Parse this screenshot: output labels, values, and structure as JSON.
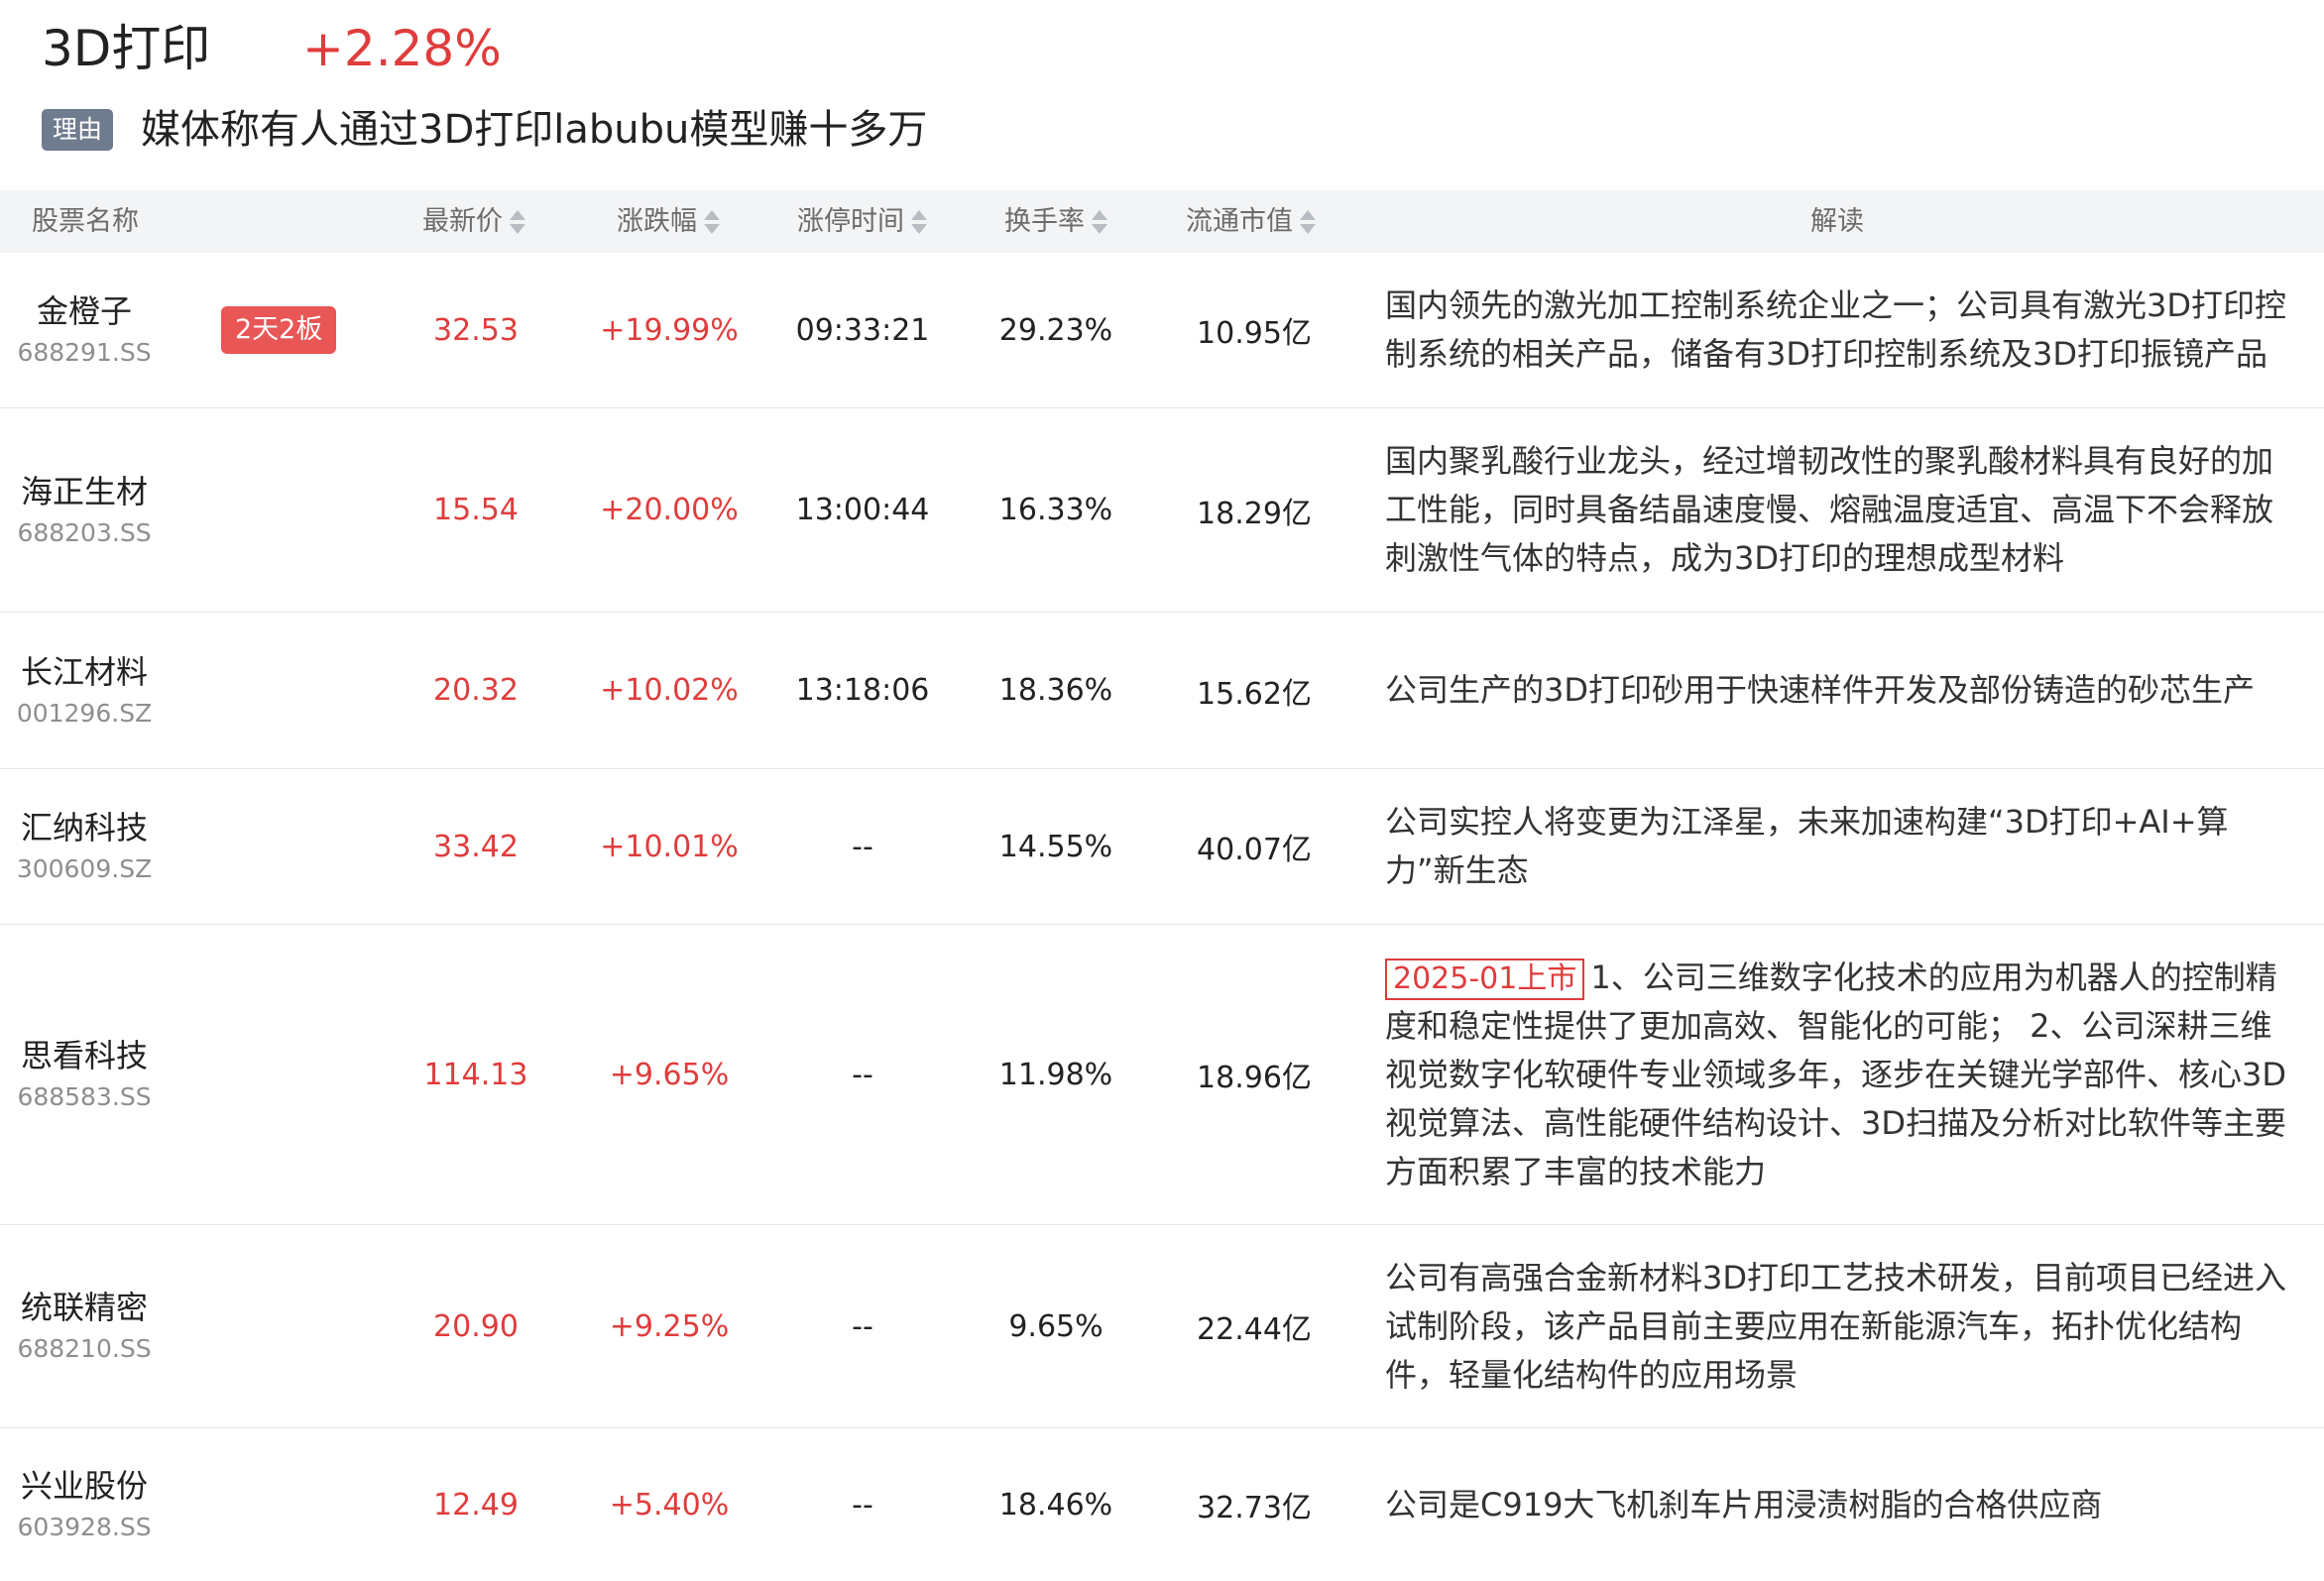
{
  "header": {
    "title": "3D打印",
    "change": "+2.28%",
    "reason_label": "理由",
    "reason_text": "媒体称有人通过3D打印labubu模型赚十多万"
  },
  "colors": {
    "up_red": "#e03c3c",
    "badge_red": "#e85656",
    "reason_badge_gray": "#6f7b8f",
    "header_bg": "#f3f4f6"
  },
  "table": {
    "columns": {
      "name": "股票名称",
      "price": "最新价",
      "change": "涨跌幅",
      "limit_time": "涨停时间",
      "turnover": "换手率",
      "float_cap": "流通市值",
      "interp": "解读"
    },
    "sort_icon": "sort-updown-icon",
    "rows": [
      {
        "name": "金橙子",
        "code": "688291.SS",
        "badge": "2天2板",
        "price": "32.53",
        "change": "+19.99%",
        "limit_time": "09:33:21",
        "turnover": "29.23%",
        "float_cap": "10.95亿",
        "tag": "",
        "interp": "国内领先的激光加工控制系统企业之一；公司具有激光3D打印控制系统的相关产品，储备有3D打印控制系统及3D打印振镜产品"
      },
      {
        "name": "海正生材",
        "code": "688203.SS",
        "badge": "",
        "price": "15.54",
        "change": "+20.00%",
        "limit_time": "13:00:44",
        "turnover": "16.33%",
        "float_cap": "18.29亿",
        "tag": "",
        "interp": "国内聚乳酸行业龙头，经过增韧改性的聚乳酸材料具有良好的加工性能，同时具备结晶速度慢、熔融温度适宜、高温下不会释放刺激性气体的特点，成为3D打印的理想成型材料"
      },
      {
        "name": "长江材料",
        "code": "001296.SZ",
        "badge": "",
        "price": "20.32",
        "change": "+10.02%",
        "limit_time": "13:18:06",
        "turnover": "18.36%",
        "float_cap": "15.62亿",
        "tag": "",
        "interp": "公司生产的3D打印砂用于快速样件开发及部份铸造的砂芯生产"
      },
      {
        "name": "汇纳科技",
        "code": "300609.SZ",
        "badge": "",
        "price": "33.42",
        "change": "+10.01%",
        "limit_time": "--",
        "turnover": "14.55%",
        "float_cap": "40.07亿",
        "tag": "",
        "interp": "公司实控人将变更为江泽星，未来加速构建“3D打印+AI+算力”新生态"
      },
      {
        "name": "思看科技",
        "code": "688583.SS",
        "badge": "",
        "price": "114.13",
        "change": "+9.65%",
        "limit_time": "--",
        "turnover": "11.98%",
        "float_cap": "18.96亿",
        "tag": "2025-01上市",
        "interp": "1、公司三维数字化技术的应用为机器人的控制精度和稳定性提供了更加高效、智能化的可能； 2、公司深耕三维视觉数字化软硬件专业领域多年，逐步在关键光学部件、核心3D视觉算法、高性能硬件结构设计、3D扫描及分析对比软件等主要方面积累了丰富的技术能力"
      },
      {
        "name": "统联精密",
        "code": "688210.SS",
        "badge": "",
        "price": "20.90",
        "change": "+9.25%",
        "limit_time": "--",
        "turnover": "9.65%",
        "float_cap": "22.44亿",
        "tag": "",
        "interp": "公司有高强合金新材料3D打印工艺技术研发，目前项目已经进入试制阶段，该产品目前主要应用在新能源汽车，拓扑优化结构件，轻量化结构件的应用场景"
      },
      {
        "name": "兴业股份",
        "code": "603928.SS",
        "badge": "",
        "price": "12.49",
        "change": "+5.40%",
        "limit_time": "--",
        "turnover": "18.46%",
        "float_cap": "32.73亿",
        "tag": "",
        "interp": "公司是C919大飞机刹车片用浸渍树脂的合格供应商"
      }
    ]
  }
}
